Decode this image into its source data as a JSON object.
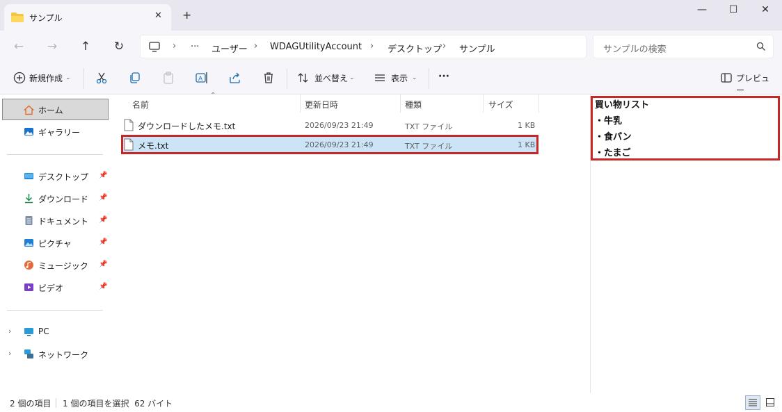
{
  "window": {
    "tab_title": "サンプル",
    "tab_close": "✕",
    "new_tab": "+",
    "minimize": "—",
    "maximize": "☐",
    "close": "✕"
  },
  "address": {
    "ellipsis": "···",
    "crumbs": [
      "ユーザー",
      "WDAGUtilityAccount",
      "デスクトップ",
      "サンプル"
    ],
    "search_placeholder": "サンプルの検索"
  },
  "toolbar": {
    "new_label": "新規作成",
    "sort_label": "並べ替え",
    "view_label": "表示",
    "more": "···",
    "preview_label": "プレビュー"
  },
  "sidebar": {
    "home": "ホーム",
    "gallery": "ギャラリー",
    "pinned": [
      {
        "label": "デスクトップ",
        "icon": "desktop-icon"
      },
      {
        "label": "ダウンロード",
        "icon": "download-icon"
      },
      {
        "label": "ドキュメント",
        "icon": "documents-icon"
      },
      {
        "label": "ピクチャ",
        "icon": "pictures-icon"
      },
      {
        "label": "ミュージック",
        "icon": "music-icon"
      },
      {
        "label": "ビデオ",
        "icon": "videos-icon"
      }
    ],
    "pc": "PC",
    "network": "ネットワーク"
  },
  "columns": {
    "name": "名前",
    "modified": "更新日時",
    "type": "種類",
    "size": "サイズ"
  },
  "files": [
    {
      "name": "ダウンロードしたメモ.txt",
      "modified": "2026/09/23 21:49",
      "type": "TXT ファイル",
      "size": "1 KB",
      "selected": false
    },
    {
      "name": "メモ.txt",
      "modified": "2026/09/23 21:49",
      "type": "TXT ファイル",
      "size": "1 KB",
      "selected": true
    }
  ],
  "preview": {
    "lines": [
      "買い物リスト",
      "・牛乳",
      "・食パン",
      "・たまご"
    ]
  },
  "status": {
    "item_count": "2 個の項目",
    "selection": "1 個の項目を選択  62 バイト"
  },
  "colors": {
    "selection": "#cce4f7",
    "highlight_border": "#c62828",
    "accent": "#0067c0"
  }
}
